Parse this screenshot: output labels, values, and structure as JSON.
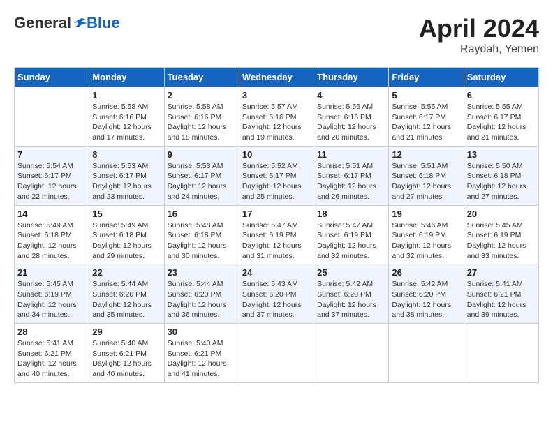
{
  "header": {
    "logo_general": "General",
    "logo_blue": "Blue",
    "month_title": "April 2024",
    "location": "Raydah, Yemen"
  },
  "days_of_week": [
    "Sunday",
    "Monday",
    "Tuesday",
    "Wednesday",
    "Thursday",
    "Friday",
    "Saturday"
  ],
  "weeks": [
    [
      {
        "day": "",
        "sunrise": "",
        "sunset": "",
        "daylight": ""
      },
      {
        "day": "1",
        "sunrise": "Sunrise: 5:58 AM",
        "sunset": "Sunset: 6:16 PM",
        "daylight": "Daylight: 12 hours and 17 minutes."
      },
      {
        "day": "2",
        "sunrise": "Sunrise: 5:58 AM",
        "sunset": "Sunset: 6:16 PM",
        "daylight": "Daylight: 12 hours and 18 minutes."
      },
      {
        "day": "3",
        "sunrise": "Sunrise: 5:57 AM",
        "sunset": "Sunset: 6:16 PM",
        "daylight": "Daylight: 12 hours and 19 minutes."
      },
      {
        "day": "4",
        "sunrise": "Sunrise: 5:56 AM",
        "sunset": "Sunset: 6:16 PM",
        "daylight": "Daylight: 12 hours and 20 minutes."
      },
      {
        "day": "5",
        "sunrise": "Sunrise: 5:55 AM",
        "sunset": "Sunset: 6:17 PM",
        "daylight": "Daylight: 12 hours and 21 minutes."
      },
      {
        "day": "6",
        "sunrise": "Sunrise: 5:55 AM",
        "sunset": "Sunset: 6:17 PM",
        "daylight": "Daylight: 12 hours and 21 minutes."
      }
    ],
    [
      {
        "day": "7",
        "sunrise": "Sunrise: 5:54 AM",
        "sunset": "Sunset: 6:17 PM",
        "daylight": "Daylight: 12 hours and 22 minutes."
      },
      {
        "day": "8",
        "sunrise": "Sunrise: 5:53 AM",
        "sunset": "Sunset: 6:17 PM",
        "daylight": "Daylight: 12 hours and 23 minutes."
      },
      {
        "day": "9",
        "sunrise": "Sunrise: 5:53 AM",
        "sunset": "Sunset: 6:17 PM",
        "daylight": "Daylight: 12 hours and 24 minutes."
      },
      {
        "day": "10",
        "sunrise": "Sunrise: 5:52 AM",
        "sunset": "Sunset: 6:17 PM",
        "daylight": "Daylight: 12 hours and 25 minutes."
      },
      {
        "day": "11",
        "sunrise": "Sunrise: 5:51 AM",
        "sunset": "Sunset: 6:17 PM",
        "daylight": "Daylight: 12 hours and 26 minutes."
      },
      {
        "day": "12",
        "sunrise": "Sunrise: 5:51 AM",
        "sunset": "Sunset: 6:18 PM",
        "daylight": "Daylight: 12 hours and 27 minutes."
      },
      {
        "day": "13",
        "sunrise": "Sunrise: 5:50 AM",
        "sunset": "Sunset: 6:18 PM",
        "daylight": "Daylight: 12 hours and 27 minutes."
      }
    ],
    [
      {
        "day": "14",
        "sunrise": "Sunrise: 5:49 AM",
        "sunset": "Sunset: 6:18 PM",
        "daylight": "Daylight: 12 hours and 28 minutes."
      },
      {
        "day": "15",
        "sunrise": "Sunrise: 5:49 AM",
        "sunset": "Sunset: 6:18 PM",
        "daylight": "Daylight: 12 hours and 29 minutes."
      },
      {
        "day": "16",
        "sunrise": "Sunrise: 5:48 AM",
        "sunset": "Sunset: 6:18 PM",
        "daylight": "Daylight: 12 hours and 30 minutes."
      },
      {
        "day": "17",
        "sunrise": "Sunrise: 5:47 AM",
        "sunset": "Sunset: 6:19 PM",
        "daylight": "Daylight: 12 hours and 31 minutes."
      },
      {
        "day": "18",
        "sunrise": "Sunrise: 5:47 AM",
        "sunset": "Sunset: 6:19 PM",
        "daylight": "Daylight: 12 hours and 32 minutes."
      },
      {
        "day": "19",
        "sunrise": "Sunrise: 5:46 AM",
        "sunset": "Sunset: 6:19 PM",
        "daylight": "Daylight: 12 hours and 32 minutes."
      },
      {
        "day": "20",
        "sunrise": "Sunrise: 5:45 AM",
        "sunset": "Sunset: 6:19 PM",
        "daylight": "Daylight: 12 hours and 33 minutes."
      }
    ],
    [
      {
        "day": "21",
        "sunrise": "Sunrise: 5:45 AM",
        "sunset": "Sunset: 6:19 PM",
        "daylight": "Daylight: 12 hours and 34 minutes."
      },
      {
        "day": "22",
        "sunrise": "Sunrise: 5:44 AM",
        "sunset": "Sunset: 6:20 PM",
        "daylight": "Daylight: 12 hours and 35 minutes."
      },
      {
        "day": "23",
        "sunrise": "Sunrise: 5:44 AM",
        "sunset": "Sunset: 6:20 PM",
        "daylight": "Daylight: 12 hours and 36 minutes."
      },
      {
        "day": "24",
        "sunrise": "Sunrise: 5:43 AM",
        "sunset": "Sunset: 6:20 PM",
        "daylight": "Daylight: 12 hours and 37 minutes."
      },
      {
        "day": "25",
        "sunrise": "Sunrise: 5:42 AM",
        "sunset": "Sunset: 6:20 PM",
        "daylight": "Daylight: 12 hours and 37 minutes."
      },
      {
        "day": "26",
        "sunrise": "Sunrise: 5:42 AM",
        "sunset": "Sunset: 6:20 PM",
        "daylight": "Daylight: 12 hours and 38 minutes."
      },
      {
        "day": "27",
        "sunrise": "Sunrise: 5:41 AM",
        "sunset": "Sunset: 6:21 PM",
        "daylight": "Daylight: 12 hours and 39 minutes."
      }
    ],
    [
      {
        "day": "28",
        "sunrise": "Sunrise: 5:41 AM",
        "sunset": "Sunset: 6:21 PM",
        "daylight": "Daylight: 12 hours and 40 minutes."
      },
      {
        "day": "29",
        "sunrise": "Sunrise: 5:40 AM",
        "sunset": "Sunset: 6:21 PM",
        "daylight": "Daylight: 12 hours and 40 minutes."
      },
      {
        "day": "30",
        "sunrise": "Sunrise: 5:40 AM",
        "sunset": "Sunset: 6:21 PM",
        "daylight": "Daylight: 12 hours and 41 minutes."
      },
      {
        "day": "",
        "sunrise": "",
        "sunset": "",
        "daylight": ""
      },
      {
        "day": "",
        "sunrise": "",
        "sunset": "",
        "daylight": ""
      },
      {
        "day": "",
        "sunrise": "",
        "sunset": "",
        "daylight": ""
      },
      {
        "day": "",
        "sunrise": "",
        "sunset": "",
        "daylight": ""
      }
    ]
  ]
}
